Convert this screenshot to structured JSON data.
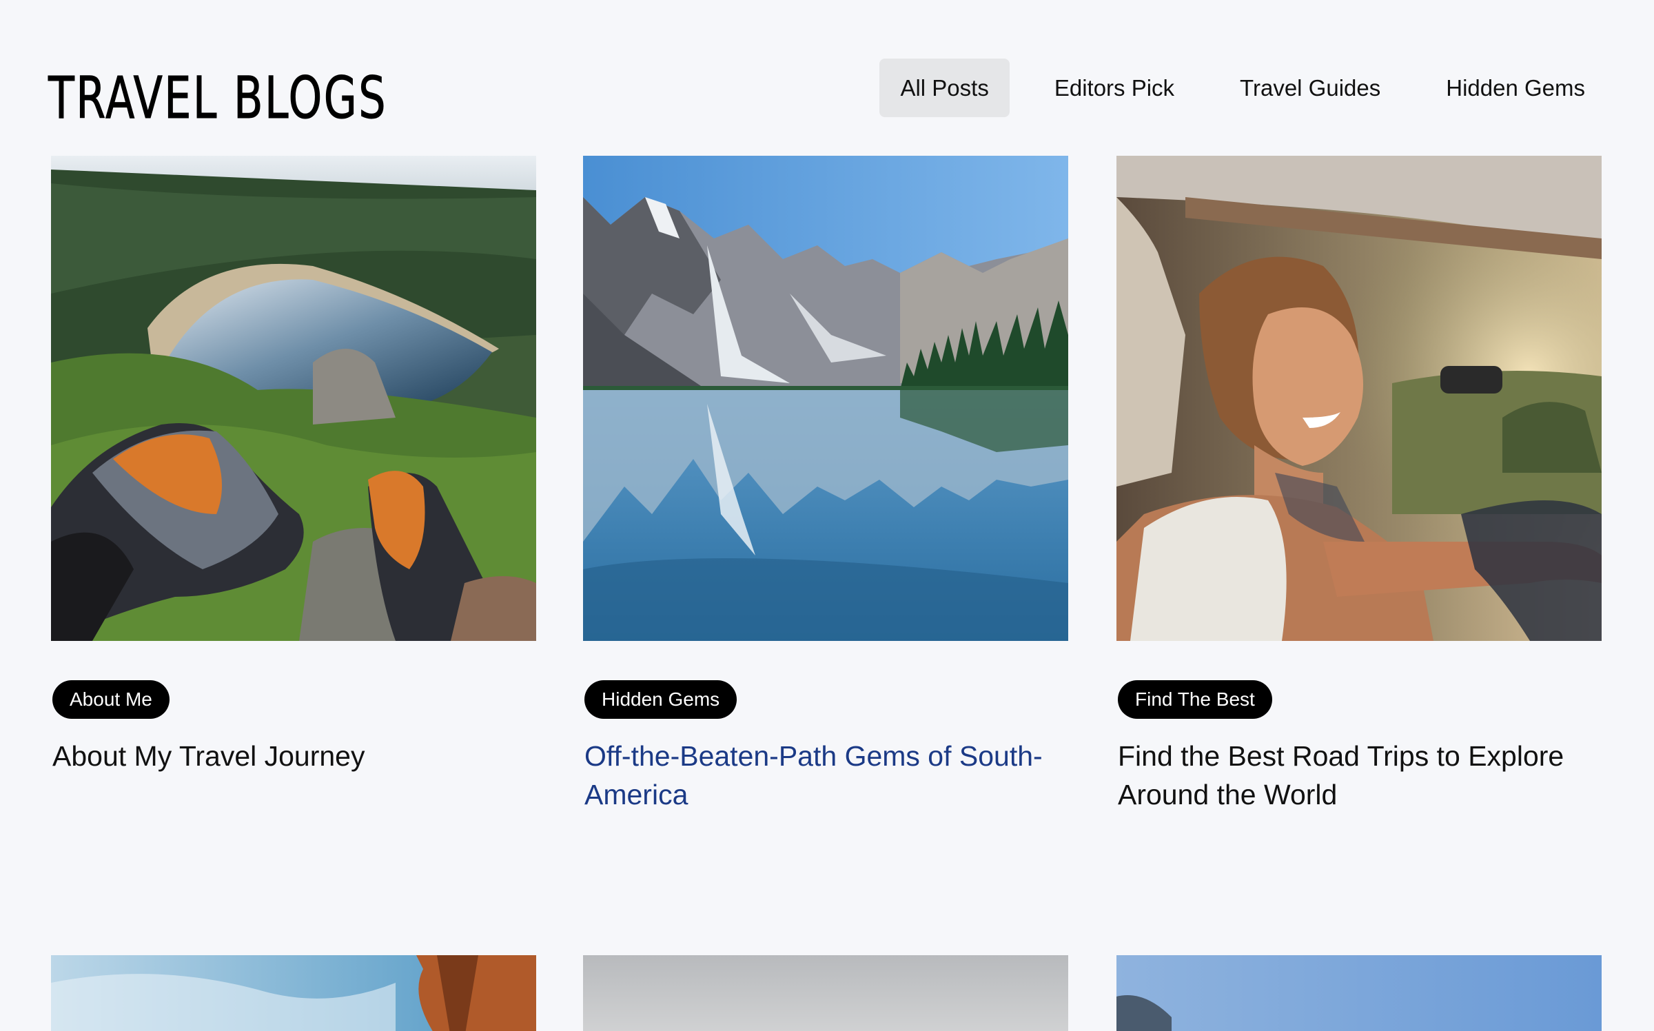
{
  "header": {
    "site_title": "TRAVEL BLOGS",
    "nav": [
      {
        "label": "All Posts",
        "active": true
      },
      {
        "label": "Editors Pick",
        "active": false
      },
      {
        "label": "Travel Guides",
        "active": false
      },
      {
        "label": "Hidden Gems",
        "active": false
      }
    ]
  },
  "posts": [
    {
      "category": "About Me",
      "title": "About My Travel Journey",
      "image": "hiking-boots-over-lake-photo"
    },
    {
      "category": "Hidden Gems",
      "title": "Off-the-Beaten-Path Gems of South-America",
      "image": "mountain-lake-reflection-photo"
    },
    {
      "category": "Find The Best",
      "title": "Find the Best Road Trips to Explore Around the World",
      "image": "woman-driving-car-photo"
    }
  ],
  "colors": {
    "background": "#f6f7fa",
    "active_tab_bg": "#e5e6e8",
    "badge_bg": "#000000",
    "link_title": "#1b3a86"
  }
}
